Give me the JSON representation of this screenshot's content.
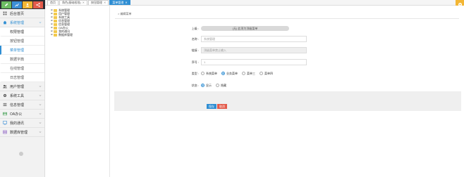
{
  "shortcuts": [
    {
      "name": "edit-icon",
      "color": "#6dbd63"
    },
    {
      "name": "chart-icon",
      "color": "#3c8fd6"
    },
    {
      "name": "user-icon",
      "color": "#f3b634"
    },
    {
      "name": "share-icon",
      "color": "#e35b4b"
    }
  ],
  "sidebar": {
    "home": "后台首页",
    "system": "系统管理",
    "sub": [
      "权限管理",
      "按钮管理",
      "菜单管理",
      "数据字典",
      "在线管理",
      "日志管理"
    ],
    "items": [
      "用户管理",
      "系统工具",
      "信息管理",
      "OA办公",
      "我的通讯",
      "数据库管理"
    ]
  },
  "tabs": [
    {
      "label": "首页"
    },
    {
      "label": "角色(基础权限)"
    },
    {
      "label": "按钮管理"
    },
    {
      "label": "菜单管理"
    }
  ],
  "tree": [
    "系统管理",
    "用户管理",
    "系统工具",
    "信息管理",
    "信息管理",
    "OA办公",
    "我的通讯",
    "数据库管理"
  ],
  "breadcrumb": "> 编辑菜单",
  "form": {
    "parent_label": "上级 :",
    "parent_value": "(无) 此项为顶级菜单",
    "name_label": "名称 :",
    "name_value": "系统管理",
    "link_label": "链接 :",
    "link_placeholder": "顶级菜单禁止输入",
    "order_label": "序号 :",
    "order_value": "1",
    "type_label": "类型 :",
    "types": [
      "系统菜单",
      "业务菜单",
      "菜单三",
      "菜单四"
    ],
    "status_label": "状态 :",
    "statuses": [
      "显示",
      "隐藏"
    ]
  },
  "buttons": {
    "save": "保存",
    "cancel": "取消"
  }
}
